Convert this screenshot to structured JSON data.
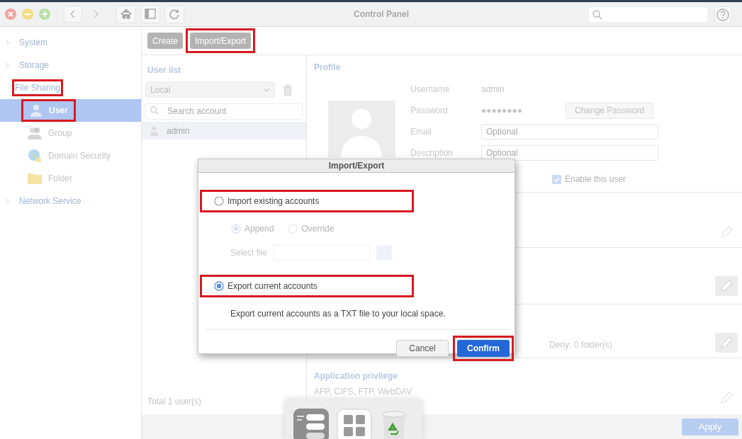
{
  "window": {
    "title": "Control Panel"
  },
  "sidebar": {
    "items": [
      {
        "label": "System",
        "expanded": false,
        "selected": false,
        "annotated": false
      },
      {
        "label": "Storage",
        "expanded": false,
        "selected": false,
        "annotated": false
      },
      {
        "label": "File Sharing",
        "expanded": true,
        "selected": false,
        "annotated": true,
        "children": [
          {
            "label": "User",
            "kind": "user",
            "selected": true,
            "annotated": true
          },
          {
            "label": "Group",
            "kind": "group",
            "selected": false,
            "annotated": false
          },
          {
            "label": "Domain Security",
            "kind": "globe",
            "selected": false,
            "annotated": false
          },
          {
            "label": "Folder",
            "kind": "folder",
            "selected": false,
            "annotated": false
          }
        ]
      },
      {
        "label": "Network Service",
        "expanded": false,
        "selected": false,
        "annotated": false
      }
    ]
  },
  "actions": [
    {
      "label": "Create",
      "annotated": false
    },
    {
      "label": "Import/Export",
      "annotated": true
    }
  ],
  "user_list": {
    "title": "User list",
    "filter": "Local",
    "search": {
      "placeholder": "Search account"
    },
    "users": [
      {
        "name": "admin",
        "selected": true
      }
    ],
    "total": "Total 1 user(s)"
  },
  "profile": {
    "title": "Profile",
    "fields": [
      {
        "kind": "text",
        "label": "Username",
        "value": "admin"
      },
      {
        "kind": "password",
        "label": "Password",
        "value": "●●●●●●●●",
        "button": "Change Password"
      },
      {
        "kind": "input",
        "label": "Email",
        "placeholder": "Optional"
      },
      {
        "kind": "input",
        "label": "Description",
        "placeholder": "Optional"
      }
    ],
    "enable": {
      "label": "Enable this user",
      "checked": true
    }
  },
  "sections": [
    {
      "kind": "plain"
    },
    {
      "kind": "boxed"
    },
    {
      "kind": "boxed",
      "text": "Deny: 0 folder(s)"
    },
    {
      "kind": "plain",
      "title": "Application privilege",
      "text": "AFP, CIFS, FTP, WebDAV"
    }
  ],
  "apply": "Apply",
  "dialog": {
    "title": "Import/Export",
    "options": [
      {
        "label": "Import existing accounts",
        "selected": false,
        "annotated": true
      },
      {
        "label": "Export current accounts",
        "selected": true,
        "annotated": true
      }
    ],
    "modes": [
      {
        "label": "Append",
        "selected": true
      },
      {
        "label": "Override",
        "selected": false
      }
    ],
    "file_label": "Select file",
    "description": "Export current accounts as a TXT file to your local space.",
    "buttons": [
      {
        "label": "Cancel",
        "kind": "secondary",
        "annotated": false
      },
      {
        "label": "Confirm",
        "kind": "primary",
        "annotated": true
      }
    ]
  },
  "dock": [
    {
      "kind": "settings"
    },
    {
      "kind": "apps"
    },
    {
      "kind": "recycle"
    }
  ]
}
